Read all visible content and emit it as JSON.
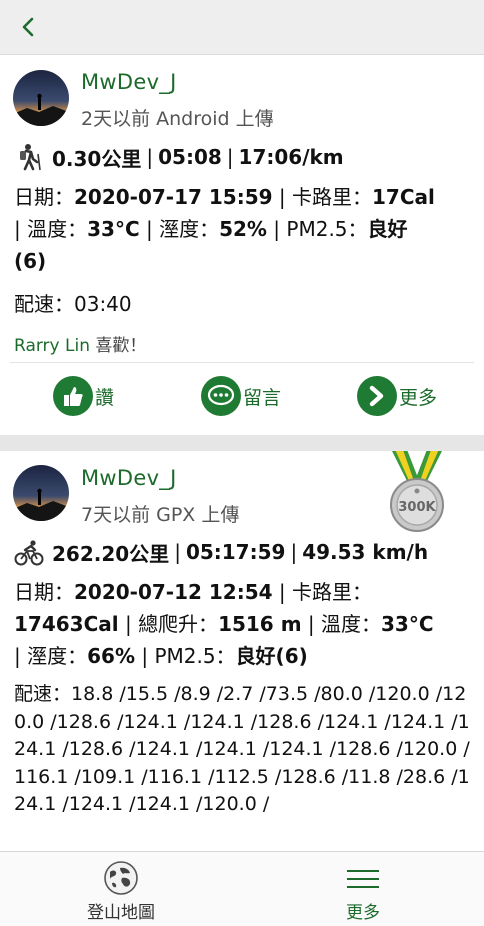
{
  "topbar": {
    "back_icon": "chevron-left-icon"
  },
  "posts": [
    {
      "username": "MwDev_J",
      "meta": "2天以前 Android 上傳",
      "activity_icon": "hiker-icon",
      "stats": {
        "distance": "0.30公里",
        "duration": "05:08",
        "pace": "17:06/km"
      },
      "detail": {
        "date_label": "日期：",
        "date": "2020-07-17 15:59",
        "cal_label": "卡路里：",
        "cal": "17Cal",
        "temp_label": "溫度：",
        "temp": "33°C",
        "humid_label": "溼度：",
        "humid": "52%",
        "pm_label": "PM2.5：",
        "pm": "良好",
        "pm_value": "(6)"
      },
      "pace_text": "配速：03:40",
      "liker": "Rarry Lin",
      "likes_suffix": " 喜歡！",
      "actions": {
        "like": "讚",
        "comment": "留言",
        "more": "更多"
      }
    },
    {
      "username": "MwDev_J",
      "meta": "7天以前 GPX 上傳",
      "activity_icon": "cyclist-icon",
      "badge": "300K",
      "stats": {
        "distance": "262.20公里",
        "duration": "05:17:59",
        "speed": "49.53 km/h"
      },
      "detail": {
        "date_label": "日期：",
        "date": "2020-07-12 12:54",
        "cal_label": "卡路里：",
        "cal": "17463Cal",
        "climb_label": "總爬升：",
        "climb": "1516 m",
        "temp_label": "溫度：",
        "temp": "33°C",
        "humid_label": "溼度：",
        "humid": "66%",
        "pm_label": "PM2.5：",
        "pm": "良好(6)"
      },
      "pace_text": "配速：18.8 /15.5 /8.9 /2.7 /73.5 /80.0 /120.0 /120.0 /128.6 /124.1 /124.1 /128.6 /124.1 /124.1 /124.1 /128.6 /124.1 /124.1 /124.1 /128.6 /120.0 /116.1 /109.1 /116.1 /112.5 /128.6 /11.8 /28.6 /124.1 /124.1 /124.1 /120.0 /"
    }
  ],
  "bottom_nav": {
    "map": "登山地圖",
    "more": "更多"
  },
  "colors": {
    "accent": "#1f7a33",
    "text_green": "#1d6b2c"
  }
}
